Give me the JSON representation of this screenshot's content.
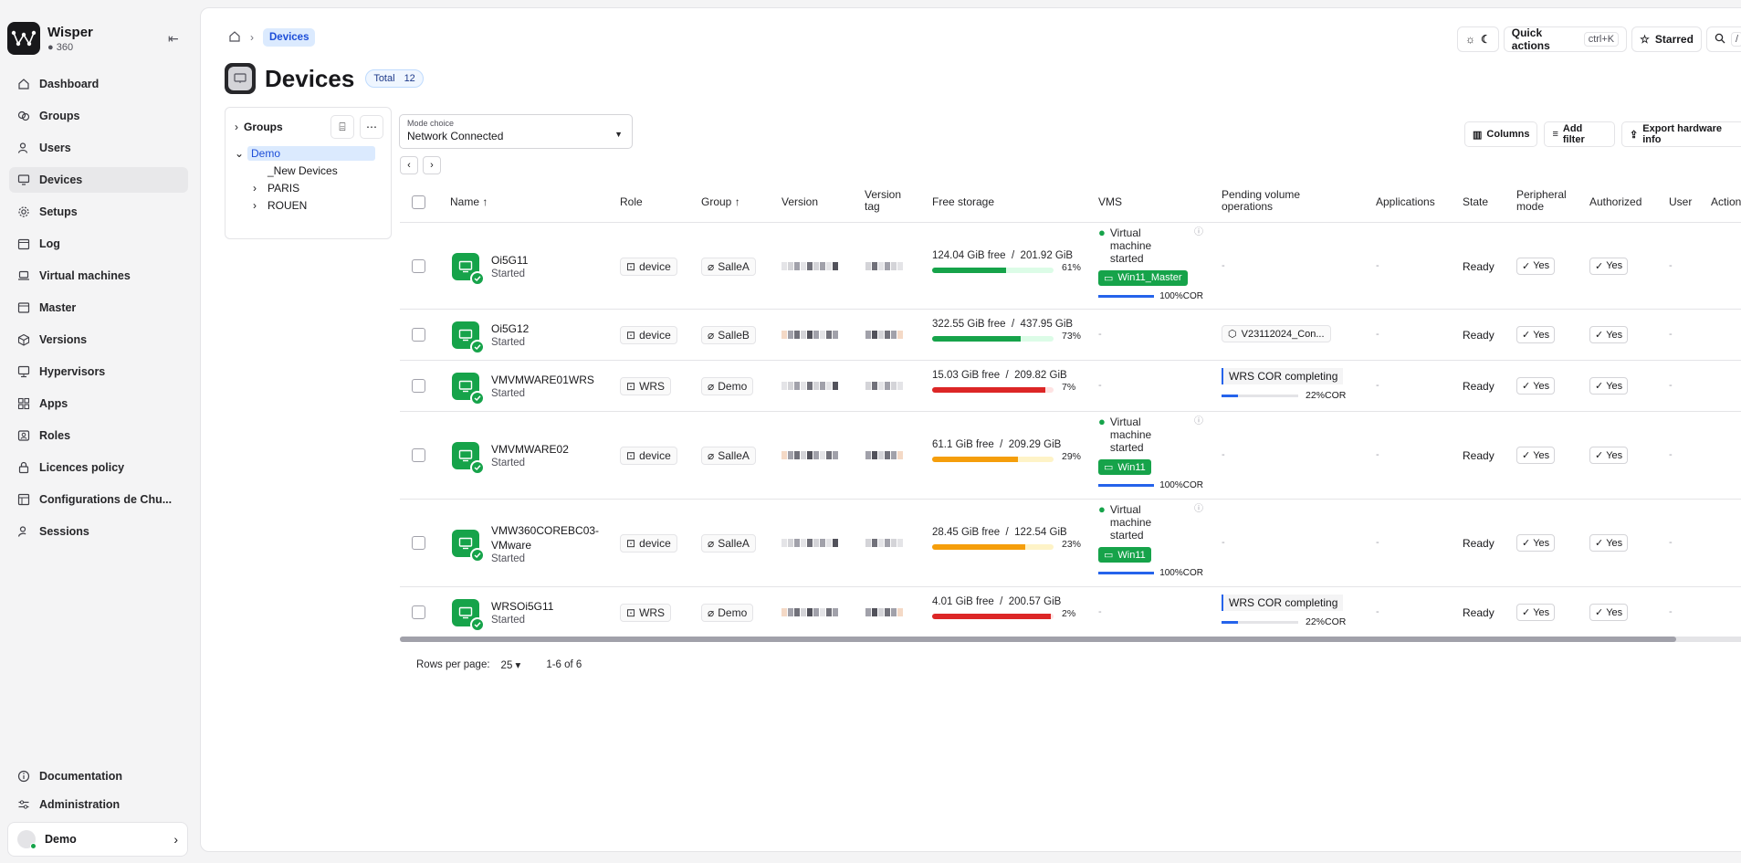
{
  "app": {
    "name": "Wisper",
    "count": "360"
  },
  "nav": {
    "items": [
      {
        "label": "Dashboard",
        "icon": "home-icon"
      },
      {
        "label": "Groups",
        "icon": "groups-icon"
      },
      {
        "label": "Users",
        "icon": "users-icon"
      },
      {
        "label": "Devices",
        "icon": "monitor-icon"
      },
      {
        "label": "Setups",
        "icon": "gear-icon"
      },
      {
        "label": "Log",
        "icon": "calendar-icon"
      },
      {
        "label": "Virtual machines",
        "icon": "laptop-icon"
      },
      {
        "label": "Master",
        "icon": "window-icon"
      },
      {
        "label": "Versions",
        "icon": "cube-icon"
      },
      {
        "label": "Hypervisors",
        "icon": "server-icon"
      },
      {
        "label": "Apps",
        "icon": "apps-icon"
      },
      {
        "label": "Roles",
        "icon": "id-card-icon"
      },
      {
        "label": "Licences policy",
        "icon": "lock-icon"
      },
      {
        "label": "Configurations de Chu...",
        "icon": "config-icon"
      },
      {
        "label": "Sessions",
        "icon": "user-clock-icon"
      }
    ],
    "bottom": [
      {
        "label": "Documentation",
        "icon": "info-icon"
      },
      {
        "label": "Administration",
        "icon": "sliders-icon"
      }
    ],
    "user": "Demo"
  },
  "breadcrumb": {
    "current": "Devices"
  },
  "topbar": {
    "quick_actions": "Quick actions",
    "shortcut": "ctrl+K",
    "starred": "Starred",
    "search_shortcut": "/"
  },
  "page": {
    "title": "Devices",
    "total_label": "Total",
    "total_value": "12"
  },
  "groups_panel": {
    "title": "Groups",
    "tree": [
      "Demo",
      "_New Devices",
      "PARIS",
      "ROUEN"
    ]
  },
  "mode": {
    "label": "Mode choice",
    "value": "Network Connected"
  },
  "tools": {
    "columns": "Columns",
    "add_filter": "Add filter",
    "export": "Export hardware info"
  },
  "columns": {
    "name": "Name",
    "role": "Role",
    "group": "Group",
    "version": "Version",
    "version_tag_1": "Version",
    "version_tag_2": "tag",
    "free_storage": "Free storage",
    "vms": "VMS",
    "pending_1": "Pending volume",
    "pending_2": "operations",
    "applications": "Applications",
    "state": "State",
    "peripheral_1": "Peripheral",
    "peripheral_2": "mode",
    "authorized": "Authorized",
    "user": "User",
    "actions": "Action"
  },
  "rows": [
    {
      "name": "Oi5G11",
      "status": "Started",
      "role": "device",
      "group": "SalleA",
      "storage": "124.04 GiB free",
      "total": "201.92 GiB",
      "pct": "61%",
      "pct_value": 61,
      "color": "#16a34a",
      "track": "#dcfce7",
      "vms": {
        "text1": "Virtual",
        "text2": "machine",
        "text3": "started",
        "badge": "Win11_Master",
        "progress": "100%COR"
      },
      "pending": "-",
      "apps": "-",
      "state": "Ready",
      "peripheral": "Yes",
      "authorized": "Yes",
      "user": "-"
    },
    {
      "name": "Oi5G12",
      "status": "Started",
      "role": "device",
      "group": "SalleB",
      "storage": "322.55 GiB free",
      "total": "437.95 GiB",
      "pct": "73%",
      "pct_value": 73,
      "color": "#16a34a",
      "track": "#dcfce7",
      "vms": null,
      "vms_dash": "-",
      "pending_tag": "V23112024_Con...",
      "apps": "-",
      "state": "Ready",
      "peripheral": "Yes",
      "authorized": "Yes",
      "user": "-"
    },
    {
      "name": "VMVMWARE01WRS",
      "status": "Started",
      "role": "WRS",
      "group": "Demo",
      "storage": "15.03 GiB free",
      "total": "209.82 GiB",
      "pct": "7%",
      "pct_value": 93,
      "color": "#dc2626",
      "track": "#fee2e2",
      "vms": null,
      "vms_dash": "-",
      "pending_wrs": {
        "label": "WRS COR completing",
        "progress": "22%COR"
      },
      "apps": "-",
      "state": "Ready",
      "peripheral": "Yes",
      "authorized": "Yes",
      "user": "-"
    },
    {
      "name": "VMVMWARE02",
      "status": "Started",
      "role": "device",
      "group": "SalleA",
      "storage": "61.1 GiB free",
      "total": "209.29 GiB",
      "pct": "29%",
      "pct_value": 71,
      "color": "#f59e0b",
      "track": "#fef3c7",
      "vms": {
        "text1": "Virtual",
        "text2": "machine",
        "text3": "started",
        "badge": "Win11",
        "progress": "100%COR"
      },
      "pending": "-",
      "apps": "-",
      "state": "Ready",
      "peripheral": "Yes",
      "authorized": "Yes",
      "user": "-"
    },
    {
      "name": "VMW360COREBC03-",
      "name2": "VMware",
      "status": "Started",
      "role": "device",
      "group": "SalleA",
      "storage": "28.45 GiB free",
      "total": "122.54 GiB",
      "pct": "23%",
      "pct_value": 77,
      "color": "#f59e0b",
      "track": "#fef3c7",
      "vms": {
        "text1": "Virtual",
        "text2": "machine",
        "text3": "started",
        "badge": "Win11",
        "progress": "100%COR"
      },
      "pending": "-",
      "apps": "-",
      "state": "Ready",
      "peripheral": "Yes",
      "authorized": "Yes",
      "user": "-"
    },
    {
      "name": "WRSOi5G11",
      "status": "Started",
      "role": "WRS",
      "group": "Demo",
      "storage": "4.01 GiB free",
      "total": "200.57 GiB",
      "pct": "2%",
      "pct_value": 98,
      "color": "#dc2626",
      "track": "#fee2e2",
      "vms": null,
      "vms_dash": "-",
      "pending_wrs": {
        "label": "WRS COR completing",
        "progress": "22%COR"
      },
      "apps": "-",
      "state": "Ready",
      "peripheral": "Yes",
      "authorized": "Yes",
      "user": "-"
    }
  ],
  "footer": {
    "rows_per_page_label": "Rows per page:",
    "rows_per_page": "25",
    "range": "1-6 of 6"
  }
}
